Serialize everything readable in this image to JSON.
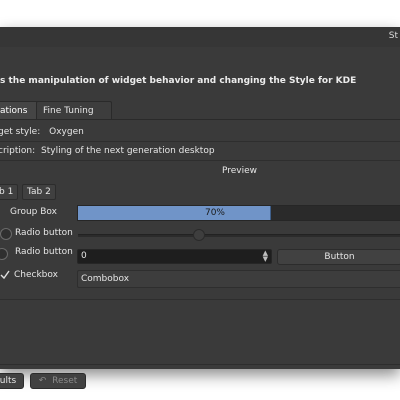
{
  "window": {
    "title": "St"
  },
  "description": "s the manipulation of widget behavior and changing the Style for KDE",
  "tabs": [
    {
      "label": "cations",
      "active": true
    },
    {
      "label": "Fine Tuning",
      "active": false
    }
  ],
  "widget_style": {
    "label": "get style:",
    "value": "Oxygen"
  },
  "style_description": {
    "label": "cription:",
    "value": "Styling of the next generation desktop"
  },
  "preview": {
    "label": "Preview",
    "mini_tabs": [
      "b 1",
      "Tab 2"
    ],
    "group_box_label": "Group Box",
    "progress": {
      "text": "70%",
      "fraction": 0.7,
      "color": "#7094c8"
    },
    "radio1": "Radio button",
    "radio2": "Radio button",
    "spin_value": "0",
    "button_label": "Button",
    "checkbox_label": "Checkbox",
    "checkbox_checked": true,
    "combo_value": "Combobox"
  },
  "footer": {
    "defaults_label": "ults",
    "reset_label": "Reset"
  }
}
